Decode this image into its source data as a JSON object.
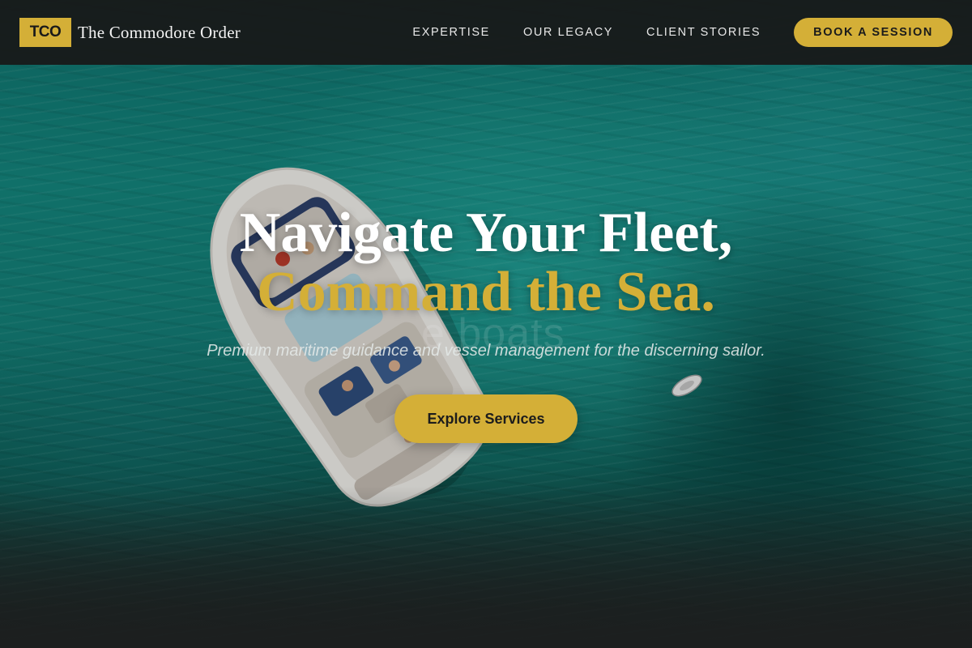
{
  "brand": {
    "logo_text": "TCO",
    "name": "The Commodore Order"
  },
  "nav": {
    "links": [
      {
        "label": "EXPERTISE"
      },
      {
        "label": "OUR LEGACY"
      },
      {
        "label": "CLIENT STORIES"
      }
    ],
    "cta_label": "BOOK A SESSION"
  },
  "hero": {
    "headline_line1": "Navigate Your Fleet,",
    "headline_line2": "Command the Sea.",
    "background_text": "e boats",
    "subheadline": "Premium maritime guidance and vessel management for the discerning sailor.",
    "button_label": "Explore Services"
  },
  "colors": {
    "accent": "#d4af37",
    "nav_bg": "#181a1a",
    "ocean": "#138078"
  },
  "icons": {
    "hero_image": "boat-aerial-image"
  }
}
